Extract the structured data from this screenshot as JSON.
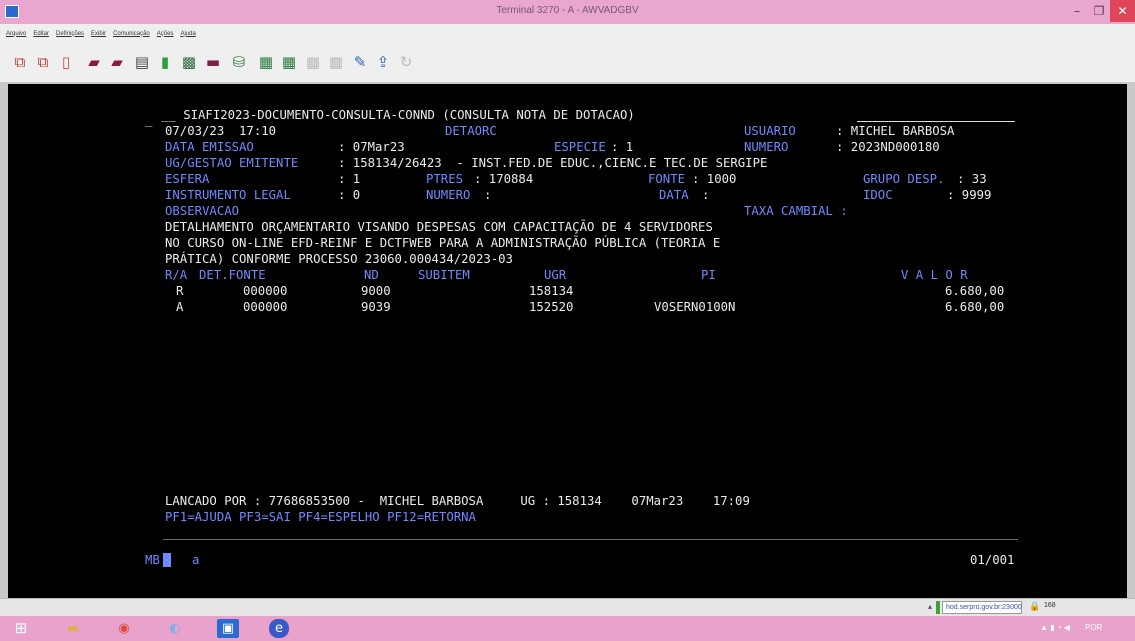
{
  "window": {
    "title": "Terminal 3270 - A - AWVADGBV",
    "min_glyph": "–",
    "max_glyph": "❐",
    "close_glyph": "✕"
  },
  "menu": [
    "Arquivo",
    "Editar",
    "Definições",
    "Exibir",
    "Comunicação",
    "Ações",
    "Ajuda"
  ],
  "toolbar_icons": [
    "copy-screen-icon",
    "paste-screen-icon",
    "print-icon",
    "send-icon",
    "receive-icon",
    "page-icon",
    "document-icon",
    "macro-icon",
    "keyboard-icon",
    "attention-icon",
    "connect-icon",
    "disconnect-icon",
    "transfer-up-icon",
    "transfer-down-icon",
    "edit-icon",
    "upload-icon",
    "refresh-icon"
  ],
  "terminal": {
    "title_line": "__ SIAFI2023-DOCUMENTO-CONSULTA-CONND (CONSULTA NOTA DE DOTACAO)",
    "date_time": "07/03/23  17:10",
    "transaction": "DETAORC",
    "usuario_label": "USUARIO",
    "usuario_value": ": MICHEL BARBOSA",
    "data_emissao_label": "DATA EMISSAO",
    "data_emissao_value": ": 07Mar23",
    "especie_label": "ESPECIE",
    "especie_value": ": 1",
    "numero_label": "NUMERO",
    "numero_value": ": 2023ND000180",
    "ug_gestao_label": "UG/GESTAO EMITENTE",
    "ug_gestao_value": ": 158134/26423  - INST.FED.DE EDUC.,CIENC.E TEC.DE SERGIPE",
    "esfera_label": "ESFERA",
    "esfera_value": ": 1",
    "ptres_label": "PTRES",
    "ptres_value": ": 170884",
    "fonte_label": "FONTE",
    "fonte_value": ": 1000",
    "grupo_desp_label": "GRUPO DESP.",
    "grupo_desp_value": ": 33",
    "instrumento_label": "INSTRUMENTO LEGAL",
    "instrumento_value": ": 0",
    "numero2_label": "NUMERO",
    "numero2_value": ":",
    "data_label": "DATA",
    "data_value": ":",
    "idoc_label": "IDOC",
    "idoc_value": ": 9999",
    "observacao_label": "OBSERVACAO",
    "taxa_label": "TAXA CAMBIAL :",
    "obs_lines": [
      "DETALHAMENTO ORÇAMENTARIO VISANDO DESPESAS COM CAPACITAÇÃO DE 4 SERVIDORES",
      "NO CURSO ON-LINE EFD-REINF E DCTFWEB PARA A ADMINISTRAÇÃO PÚBLICA (TEORIA E",
      "PRÁTICA) CONFORME PROCESSO 23060.000434/2023-03"
    ],
    "table_headers": [
      "R/A",
      "DET.FONTE",
      "ND",
      "SUBITEM",
      "UGR",
      "PI",
      "V A L O R"
    ],
    "table_rows": [
      [
        "R",
        "000000",
        "9000",
        "",
        "158134",
        "",
        "6.680,00"
      ],
      [
        "A",
        "000000",
        "9039",
        "",
        "152520",
        "V0SERN0100N",
        "6.680,00"
      ]
    ],
    "lancado_line": "LANCADO POR : 77686853500 -  MICHEL BARBOSA     UG : 158134    07Mar23    17:09",
    "pf_keys": "PF1=AJUDA PF3=SAI PF4=ESPELHO PF12=RETORNA",
    "command_prefix": "MB",
    "command_input": "a",
    "page_indicator": "01/001"
  },
  "statusbar": {
    "host": "hod.serpro.gov.br:23000",
    "code": "168"
  },
  "taskbar": {
    "apps": [
      "windows-start-icon",
      "file-explorer-icon",
      "chrome-icon",
      "app-icon",
      "terminal-icon",
      "edge-icon"
    ],
    "lang": "POR"
  }
}
